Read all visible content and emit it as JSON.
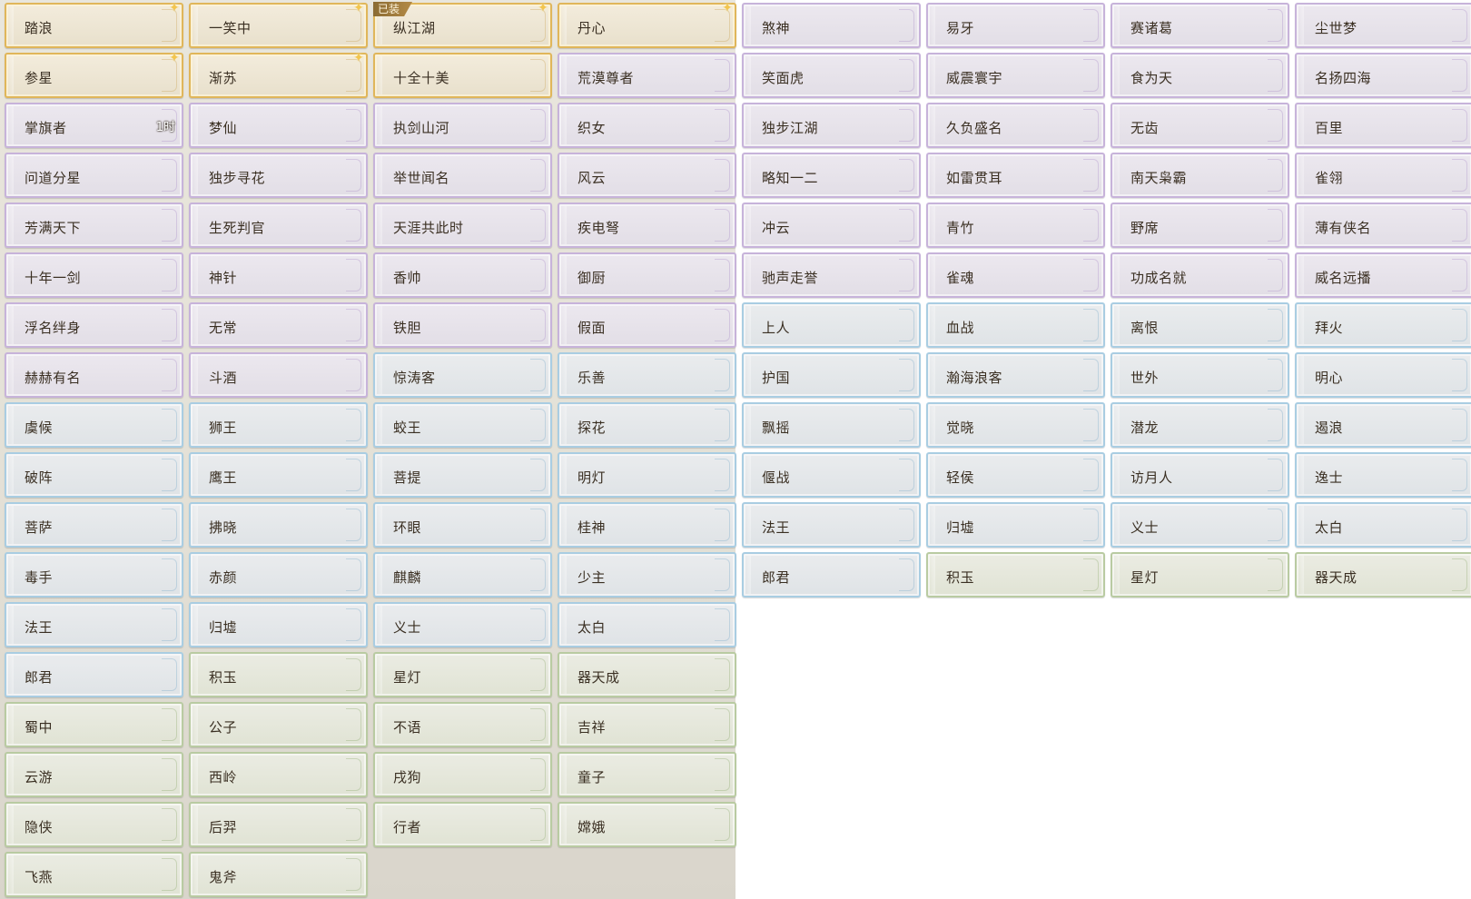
{
  "colors": {
    "gold_border": "#e0b65a",
    "purple_border": "#c7b3da",
    "blue_border": "#a9cde2",
    "green_border": "#b9cba2",
    "text": "#3a2f22"
  },
  "titles": [
    {
      "label": "踏浪",
      "tier": "gold",
      "sparkle": true
    },
    {
      "label": "一笑中",
      "tier": "gold",
      "sparkle": true
    },
    {
      "label": "纵江湖",
      "tier": "gold",
      "sparkle": true,
      "badge": "已装"
    },
    {
      "label": "丹心",
      "tier": "gold",
      "sparkle": true
    },
    {
      "label": "煞神",
      "tier": "purple"
    },
    {
      "label": "易牙",
      "tier": "purple"
    },
    {
      "label": "赛诸葛",
      "tier": "purple"
    },
    {
      "label": "尘世梦",
      "tier": "purple"
    },
    {
      "label": "参星",
      "tier": "gold",
      "sparkle": true
    },
    {
      "label": "渐苏",
      "tier": "gold",
      "sparkle": true
    },
    {
      "label": "十全十美",
      "tier": "gold"
    },
    {
      "label": "荒漠尊者",
      "tier": "purple"
    },
    {
      "label": "笑面虎",
      "tier": "purple"
    },
    {
      "label": "威震寰宇",
      "tier": "purple"
    },
    {
      "label": "食为天",
      "tier": "purple"
    },
    {
      "label": "名扬四海",
      "tier": "purple"
    },
    {
      "label": "掌旗者",
      "tier": "purple",
      "timer": "1时"
    },
    {
      "label": "梦仙",
      "tier": "purple"
    },
    {
      "label": "执剑山河",
      "tier": "purple"
    },
    {
      "label": "织女",
      "tier": "purple"
    },
    {
      "label": "独步江湖",
      "tier": "purple"
    },
    {
      "label": "久负盛名",
      "tier": "purple"
    },
    {
      "label": "无齿",
      "tier": "purple"
    },
    {
      "label": "百里",
      "tier": "purple"
    },
    {
      "label": "问道分星",
      "tier": "purple"
    },
    {
      "label": "独步寻花",
      "tier": "purple"
    },
    {
      "label": "举世闻名",
      "tier": "purple"
    },
    {
      "label": "风云",
      "tier": "purple"
    },
    {
      "label": "略知一二",
      "tier": "purple"
    },
    {
      "label": "如雷贯耳",
      "tier": "purple"
    },
    {
      "label": "南天枭霸",
      "tier": "purple"
    },
    {
      "label": "雀翎",
      "tier": "purple"
    },
    {
      "label": "芳满天下",
      "tier": "purple"
    },
    {
      "label": "生死判官",
      "tier": "purple"
    },
    {
      "label": "天涯共此时",
      "tier": "purple"
    },
    {
      "label": "疾电弩",
      "tier": "purple"
    },
    {
      "label": "冲云",
      "tier": "purple"
    },
    {
      "label": "青竹",
      "tier": "purple"
    },
    {
      "label": "野席",
      "tier": "purple"
    },
    {
      "label": "薄有侠名",
      "tier": "purple"
    },
    {
      "label": "十年一剑",
      "tier": "purple"
    },
    {
      "label": "神针",
      "tier": "purple"
    },
    {
      "label": "香帅",
      "tier": "purple"
    },
    {
      "label": "御厨",
      "tier": "purple"
    },
    {
      "label": "驰声走誉",
      "tier": "purple"
    },
    {
      "label": "雀魂",
      "tier": "purple"
    },
    {
      "label": "功成名就",
      "tier": "purple"
    },
    {
      "label": "威名远播",
      "tier": "purple"
    },
    {
      "label": "浮名绊身",
      "tier": "purple"
    },
    {
      "label": "无常",
      "tier": "purple"
    },
    {
      "label": "铁胆",
      "tier": "purple"
    },
    {
      "label": "假面",
      "tier": "purple"
    },
    {
      "label": "上人",
      "tier": "blue"
    },
    {
      "label": "血战",
      "tier": "blue"
    },
    {
      "label": "离恨",
      "tier": "blue"
    },
    {
      "label": "拜火",
      "tier": "blue"
    },
    {
      "label": "赫赫有名",
      "tier": "purple"
    },
    {
      "label": "斗酒",
      "tier": "purple"
    },
    {
      "label": "惊涛客",
      "tier": "blue"
    },
    {
      "label": "乐善",
      "tier": "blue"
    },
    {
      "label": "护国",
      "tier": "blue"
    },
    {
      "label": "瀚海浪客",
      "tier": "blue"
    },
    {
      "label": "世外",
      "tier": "blue"
    },
    {
      "label": "明心",
      "tier": "blue"
    },
    {
      "label": "虞候",
      "tier": "blue"
    },
    {
      "label": "狮王",
      "tier": "blue"
    },
    {
      "label": "蛟王",
      "tier": "blue"
    },
    {
      "label": "探花",
      "tier": "blue"
    },
    {
      "label": "飘摇",
      "tier": "blue"
    },
    {
      "label": "觉晓",
      "tier": "blue"
    },
    {
      "label": "潜龙",
      "tier": "blue"
    },
    {
      "label": "遏浪",
      "tier": "blue"
    },
    {
      "label": "破阵",
      "tier": "blue"
    },
    {
      "label": "鹰王",
      "tier": "blue"
    },
    {
      "label": "菩提",
      "tier": "blue"
    },
    {
      "label": "明灯",
      "tier": "blue"
    },
    {
      "label": "偃战",
      "tier": "blue"
    },
    {
      "label": "轻侯",
      "tier": "blue"
    },
    {
      "label": "访月人",
      "tier": "blue"
    },
    {
      "label": "逸士",
      "tier": "blue"
    },
    {
      "label": "菩萨",
      "tier": "blue"
    },
    {
      "label": "拂晓",
      "tier": "blue"
    },
    {
      "label": "环眼",
      "tier": "blue"
    },
    {
      "label": "桂神",
      "tier": "blue"
    },
    {
      "label": "法王",
      "tier": "blue"
    },
    {
      "label": "归墟",
      "tier": "blue"
    },
    {
      "label": "义士",
      "tier": "blue"
    },
    {
      "label": "太白",
      "tier": "blue"
    },
    {
      "label": "毒手",
      "tier": "blue"
    },
    {
      "label": "赤颜",
      "tier": "blue"
    },
    {
      "label": "麒麟",
      "tier": "blue"
    },
    {
      "label": "少主",
      "tier": "blue"
    },
    {
      "label": "郎君",
      "tier": "blue"
    },
    {
      "label": "积玉",
      "tier": "green"
    },
    {
      "label": "星灯",
      "tier": "green"
    },
    {
      "label": "器天成",
      "tier": "green"
    },
    {
      "label": "法王",
      "tier": "blue"
    },
    {
      "label": "归墟",
      "tier": "blue"
    },
    {
      "label": "义士",
      "tier": "blue"
    },
    {
      "label": "太白",
      "tier": "blue"
    },
    {
      "label": null
    },
    {
      "label": null
    },
    {
      "label": null
    },
    {
      "label": null
    },
    {
      "label": "郎君",
      "tier": "blue"
    },
    {
      "label": "积玉",
      "tier": "green"
    },
    {
      "label": "星灯",
      "tier": "green"
    },
    {
      "label": "器天成",
      "tier": "green"
    },
    {
      "label": null
    },
    {
      "label": null
    },
    {
      "label": null
    },
    {
      "label": null
    },
    {
      "label": "蜀中",
      "tier": "green"
    },
    {
      "label": "公子",
      "tier": "green"
    },
    {
      "label": "不语",
      "tier": "green"
    },
    {
      "label": "吉祥",
      "tier": "green"
    },
    {
      "label": null
    },
    {
      "label": null
    },
    {
      "label": null
    },
    {
      "label": null
    },
    {
      "label": "云游",
      "tier": "green"
    },
    {
      "label": "西岭",
      "tier": "green"
    },
    {
      "label": "戌狗",
      "tier": "green"
    },
    {
      "label": "童子",
      "tier": "green"
    },
    {
      "label": null
    },
    {
      "label": null
    },
    {
      "label": null
    },
    {
      "label": null
    },
    {
      "label": "隐侠",
      "tier": "green"
    },
    {
      "label": "后羿",
      "tier": "green"
    },
    {
      "label": "行者",
      "tier": "green"
    },
    {
      "label": "嫦娥",
      "tier": "green"
    },
    {
      "label": null
    },
    {
      "label": null
    },
    {
      "label": null
    },
    {
      "label": null
    },
    {
      "label": "飞燕",
      "tier": "green"
    },
    {
      "label": "鬼斧",
      "tier": "green"
    }
  ]
}
